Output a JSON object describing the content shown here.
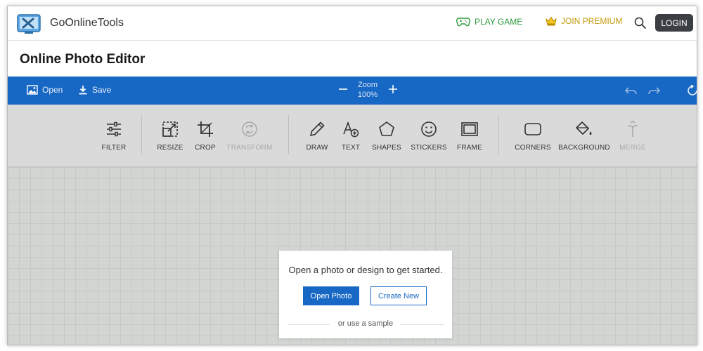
{
  "header": {
    "brand": "GoOnlineTools",
    "play_game": "PLAY GAME",
    "join_premium": "JOIN PREMIUM",
    "login": "LOGIN"
  },
  "page": {
    "title": "Online Photo Editor"
  },
  "toolbar": {
    "open": "Open",
    "save": "Save",
    "zoom_label": "Zoom",
    "zoom_value": "100%"
  },
  "tools": [
    {
      "label": "FILTER",
      "icon": "sliders-icon"
    },
    {
      "label": "RESIZE",
      "icon": "resize-icon"
    },
    {
      "label": "CROP",
      "icon": "crop-icon"
    },
    {
      "label": "TRANSFORM",
      "icon": "transform-icon",
      "disabled": true
    },
    {
      "label": "DRAW",
      "icon": "pencil-icon"
    },
    {
      "label": "TEXT",
      "icon": "text-icon"
    },
    {
      "label": "SHAPES",
      "icon": "pentagon-icon"
    },
    {
      "label": "STICKERS",
      "icon": "smiley-icon"
    },
    {
      "label": "FRAME",
      "icon": "frame-icon"
    },
    {
      "label": "CORNERS",
      "icon": "rounded-rect-icon"
    },
    {
      "label": "BACKGROUND",
      "icon": "paint-bucket-icon"
    },
    {
      "label": "MERGE",
      "icon": "merge-icon",
      "disabled": true
    }
  ],
  "start": {
    "message": "Open a photo or design to get started.",
    "open_photo": "Open Photo",
    "create_new": "Create New",
    "sample": "or use a sample"
  },
  "colors": {
    "accent_blue": "#1767c4",
    "play_green": "#2e9a3c",
    "premium_gold": "#c49a0a",
    "login_bg": "#3b3f44"
  }
}
